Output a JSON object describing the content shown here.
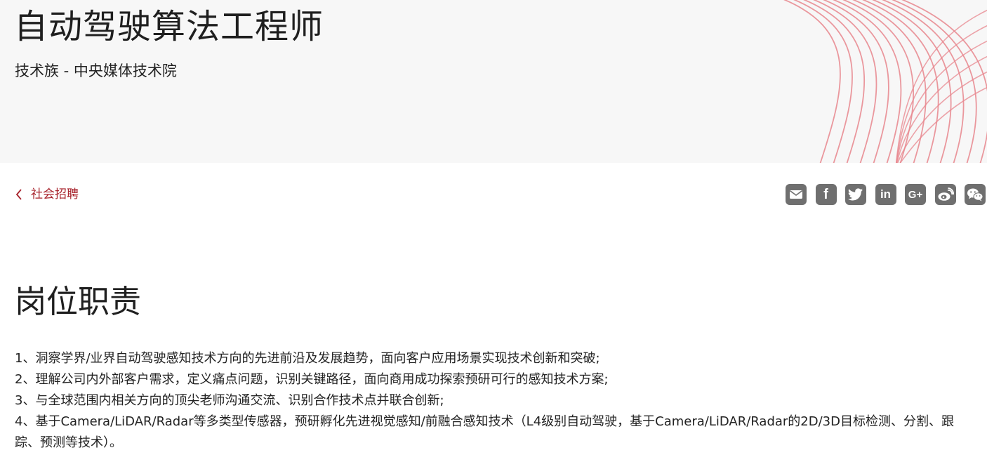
{
  "header": {
    "title": "自动驾驶算法工程师",
    "department": "技术族 - 中央媒体技术院"
  },
  "nav": {
    "back_label": "社会招聘"
  },
  "share": {
    "items": [
      {
        "name": "email",
        "icon": "mail-icon"
      },
      {
        "name": "facebook",
        "icon": "facebook-icon",
        "glyph": "f"
      },
      {
        "name": "twitter",
        "icon": "twitter-icon"
      },
      {
        "name": "linkedin",
        "icon": "linkedin-icon",
        "glyph": "in"
      },
      {
        "name": "googleplus",
        "icon": "google-plus-icon",
        "glyph": "G+"
      },
      {
        "name": "weibo",
        "icon": "weibo-icon"
      },
      {
        "name": "wechat",
        "icon": "wechat-icon"
      }
    ]
  },
  "responsibilities": {
    "heading": "岗位职责",
    "items": [
      "1、洞察学界/业界自动驾驶感知技术方向的先进前沿及发展趋势，面向客户应用场景实现技术创新和突破;",
      "2、理解公司内外部客户需求，定义痛点问题，识别关键路径，面向商用成功探索预研可行的感知技术方案;",
      "3、与全球范围内相关方向的顶尖老师沟通交流、识别合作技术点并联合创新;",
      "4、基于Camera/LiDAR/Radar等多类型传感器，预研孵化先进视觉感知/前融合感知技术（L4级别自动驾驶，基于Camera/LiDAR/Radar的2D/3D目标检测、分割、跟踪、预测等技术）。"
    ]
  },
  "colors": {
    "accent": "#a8242d",
    "banner_bg": "#f7f7f7",
    "deco_lines": "#e8868d",
    "share_icon_bg": "#6f6f6f"
  }
}
